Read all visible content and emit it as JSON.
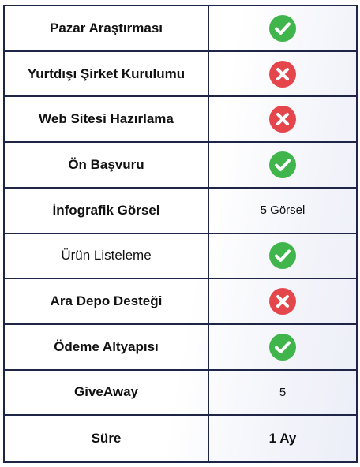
{
  "colors": {
    "border": "#1f2547",
    "check": "#3fb54b",
    "cross": "#e5464c"
  },
  "rows": [
    {
      "label": "Pazar Araştırması",
      "label_bold": true,
      "value_type": "icon",
      "icon": "check-icon"
    },
    {
      "label": "Yurtdışı Şirket Kurulumu",
      "label_bold": true,
      "value_type": "icon",
      "icon": "cross-icon"
    },
    {
      "label": "Web Sitesi Hazırlama",
      "label_bold": true,
      "value_type": "icon",
      "icon": "cross-icon"
    },
    {
      "label": "Ön Başvuru",
      "label_bold": true,
      "value_type": "icon",
      "icon": "check-icon"
    },
    {
      "label": "İnfografik Görsel",
      "label_bold": true,
      "value_type": "text",
      "value": "5 Görsel",
      "value_bold": false
    },
    {
      "label": "Ürün Listeleme",
      "label_bold": false,
      "value_type": "icon",
      "icon": "check-icon"
    },
    {
      "label": "Ara Depo Desteği",
      "label_bold": true,
      "value_type": "icon",
      "icon": "cross-icon"
    },
    {
      "label": "Ödeme Altyapısı",
      "label_bold": true,
      "value_type": "icon",
      "icon": "check-icon"
    },
    {
      "label": "GiveAway",
      "label_bold": true,
      "value_type": "text",
      "value": "5",
      "value_bold": false
    },
    {
      "label": "Süre",
      "label_bold": true,
      "value_type": "text",
      "value": "1 Ay",
      "value_bold": true
    }
  ]
}
